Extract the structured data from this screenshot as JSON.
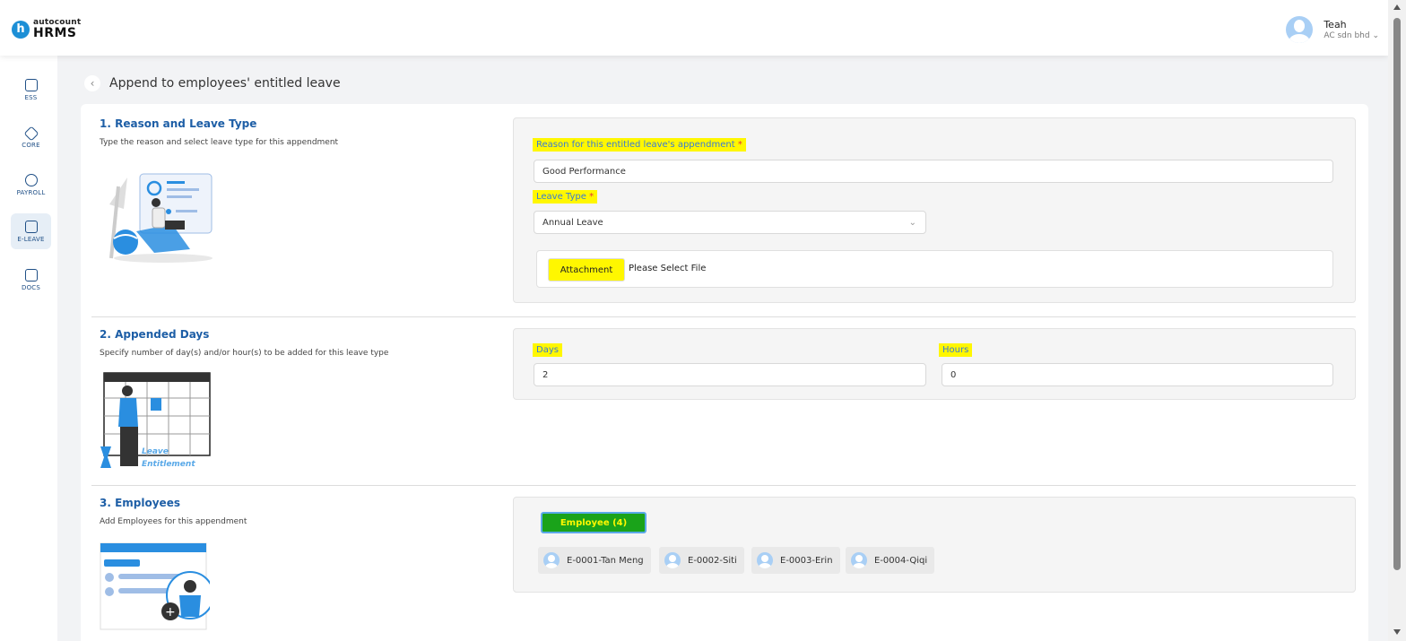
{
  "brand": {
    "small": "autocount",
    "big": "HRMS",
    "mark": "h"
  },
  "user": {
    "name": "Teah",
    "company": "AC sdn bhd"
  },
  "sidebar": {
    "items": [
      {
        "label": "ESS"
      },
      {
        "label": "CORE"
      },
      {
        "label": "PAYROLL"
      },
      {
        "label": "E-LEAVE"
      },
      {
        "label": "DOCS"
      }
    ]
  },
  "page": {
    "title": "Append to employees' entitled leave"
  },
  "section1": {
    "title": "1. Reason and Leave Type",
    "desc": "Type the reason and select leave type for this appendment",
    "reason_label": "Reason for this entitled leave's appendment",
    "reason_value": "Good Performance",
    "leave_type_label": "Leave Type",
    "leave_type_value": "Annual Leave",
    "attachment_button": "Attachment",
    "attachment_text": "Please Select File"
  },
  "section2": {
    "title": "2. Appended Days",
    "desc": "Specify number of day(s) and/or hour(s) to be added for this leave type",
    "days_label": "Days",
    "days_value": "2",
    "hours_label": "Hours",
    "hours_value": "0",
    "illus_text_1": "Leave",
    "illus_text_2": "Entitlement"
  },
  "section3": {
    "title": "3. Employees",
    "desc": "Add Employees for this appendment",
    "employee_button": "Employee (4)",
    "employees": [
      "E-0001-Tan Meng",
      "E-0002-Siti",
      "E-0003-Erin",
      "E-0004-Qiqi"
    ]
  },
  "colors": {
    "accent": "#1d5ea6",
    "highlight": "#fff700",
    "button_green": "#1aa31a"
  }
}
